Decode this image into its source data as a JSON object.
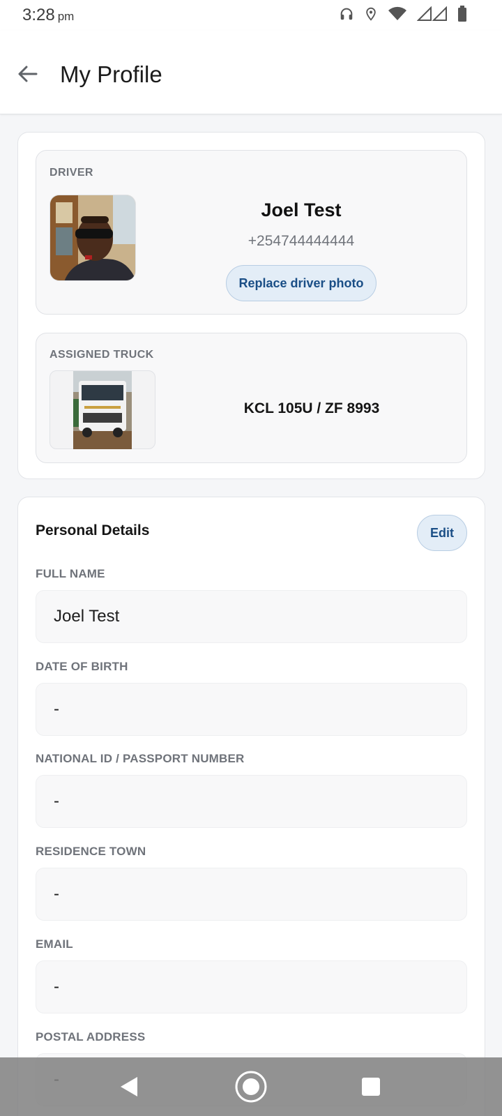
{
  "status_bar": {
    "time": "3:28",
    "ampm": "pm",
    "icons": [
      "headset-icon",
      "location-pin-icon",
      "wifi-icon",
      "signal-icon",
      "battery-icon"
    ]
  },
  "header": {
    "title": "My Profile",
    "back_icon": "arrow-left-icon"
  },
  "driver": {
    "section_label": "DRIVER",
    "name": "Joel Test",
    "phone": "+254744444444",
    "replace_photo_label": "Replace driver photo"
  },
  "truck": {
    "section_label": "ASSIGNED TRUCK",
    "plate": "KCL 105U / ZF 8993"
  },
  "personal_details": {
    "title": "Personal Details",
    "edit_label": "Edit",
    "fields": [
      {
        "label": "FULL NAME",
        "value": "Joel Test"
      },
      {
        "label": "DATE OF BIRTH",
        "value": "-"
      },
      {
        "label": "NATIONAL ID / PASSPORT NUMBER",
        "value": "-"
      },
      {
        "label": "RESIDENCE TOWN",
        "value": "-"
      },
      {
        "label": "EMAIL",
        "value": "-"
      },
      {
        "label": "POSTAL ADDRESS",
        "value": "-"
      }
    ]
  },
  "colors": {
    "accent": "#1a4e86",
    "accent_bg": "#e3edf7",
    "background": "#f5f6f8",
    "label": "#6f737a"
  },
  "nav_bar": {
    "icons": [
      "back-triangle-icon",
      "home-circle-icon",
      "recents-square-icon"
    ]
  }
}
